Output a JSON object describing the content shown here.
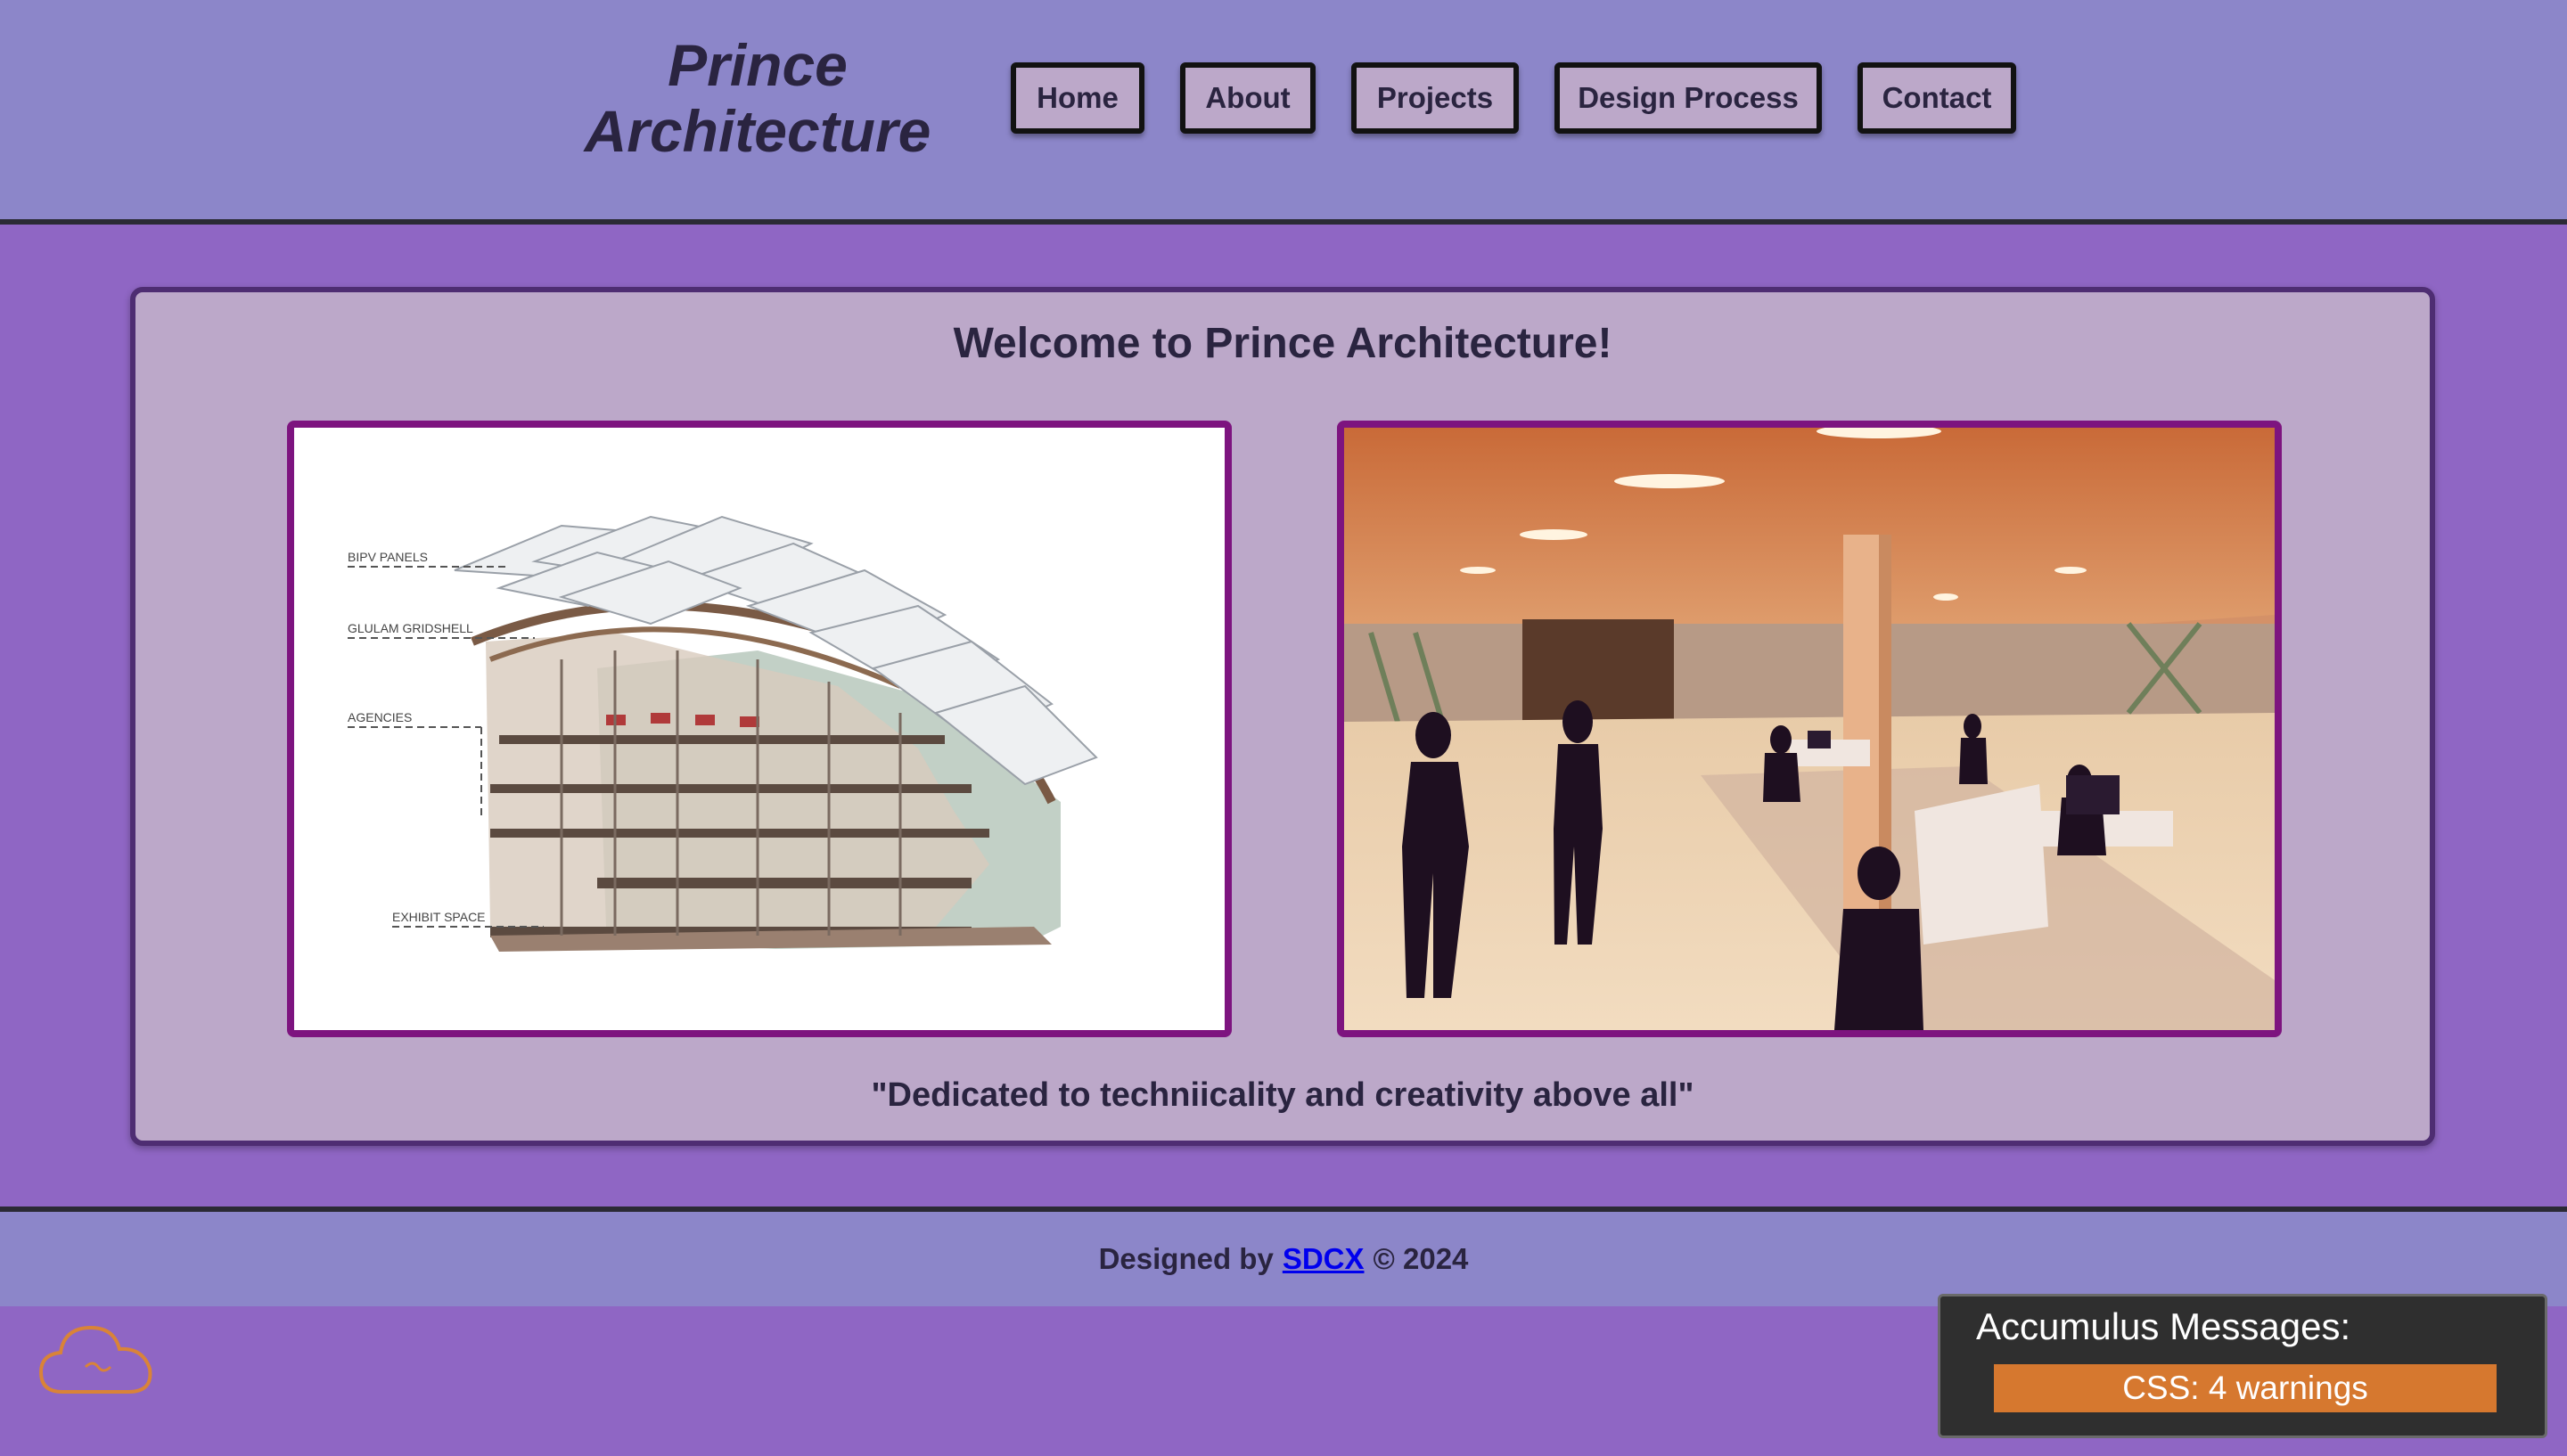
{
  "header": {
    "brand_line1": "Prince",
    "brand_line2": "Architecture",
    "nav": [
      {
        "label": "Home"
      },
      {
        "label": "About"
      },
      {
        "label": "Projects"
      },
      {
        "label": "Design Process"
      },
      {
        "label": "Contact"
      }
    ]
  },
  "main": {
    "heading": "Welcome to Prince Architecture!",
    "diagram_labels": [
      "BIPV PANELS",
      "GLULAM GRIDSHELL",
      "AGENCIES",
      "EXHIBIT SPACE"
    ],
    "tagline": "\"Dedicated to techniicality and creativity above all\""
  },
  "footer": {
    "prefix": "Designed by",
    "link": "SDCX",
    "suffix": "© 2024"
  },
  "messages": {
    "title": "Accumulus Messages:",
    "badge": "CSS: 4 warnings"
  },
  "colors": {
    "page_bg": "#8f66c4",
    "header_bg": "#8c86c9",
    "card_bg": "#bca8c9",
    "image_frame": "#7d147f",
    "link": "#0000ee",
    "warning_badge": "#d6782f"
  }
}
